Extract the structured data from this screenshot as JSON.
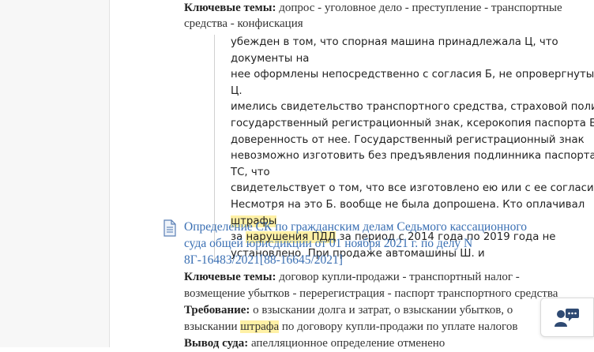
{
  "result1": {
    "keywords_label": "Ключевые темы:",
    "keywords_line1": "допрос - уголовное дело - преступление - транспортные",
    "keywords_line2": "средства - конфискация",
    "snippet": [
      {
        "text": "убежден в том, что спорная машина принадлежала Ц, что документы на"
      },
      {
        "text": "нее оформлены непосредственно с согласия Б, не опровергнуты. У Ц."
      },
      {
        "text": "имелись свидетельство транспортного средства, страховой полис,"
      },
      {
        "text": "государственный регистрационный знак, ксерокопия паспорта Б,"
      },
      {
        "text": "доверенность от нее. Государственный регистрационный знак"
      },
      {
        "text": "невозможно изготовить без предъявления подлинника паспорта ТС, что"
      },
      {
        "text": "свидетельствует о том, что все изготовлено ею или с ее согласия."
      },
      {
        "pre": "Несмотря на это Б. вообще не была допрошена. Кто оплачивал ",
        "hl": "штрафы",
        "post": ""
      },
      {
        "pre": "за ",
        "hl": "нарушения ПДД",
        "post": " за период с 2014 года по 2019 года не"
      },
      {
        "text": "установлено. При продаже автомашины Ш. и"
      }
    ]
  },
  "result2": {
    "icon": "document-icon",
    "title_line1": "Определение СК по гражданским делам Седьмого кассационного",
    "title_line2": "суда общей юрисдикции от 01 ноября 2021 г. по делу N",
    "title_line3": "8Г-16483/2021[88-16645/2021]",
    "keywords_label": "Ключевые темы:",
    "keywords_line1": "договор купли-продажи - транспортный налог -",
    "keywords_line2": "возмещение убытков - перерегистрация - паспорт транспортного средства",
    "requirement_label": "Требование:",
    "requirement_line1": "о взыскании долга и затрат, о взыскании убытков, о",
    "requirement_line2_pre": "взыскании ",
    "requirement_line2_hl": "штрафа",
    "requirement_line2_post": " по договору купли-продажи по уплате налогов",
    "conclusion_label": "Вывод суда:",
    "conclusion_line1": "апелляционное определение отменено"
  },
  "chat_widget": {
    "icon": "chat-support-icon",
    "accent": "#2f4a73"
  }
}
